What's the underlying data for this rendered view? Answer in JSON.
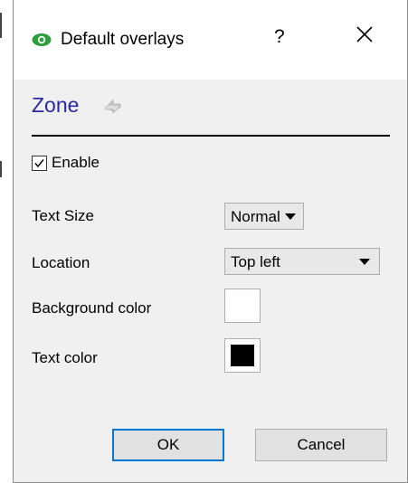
{
  "window": {
    "title": "Default overlays",
    "help_label": "?",
    "close_label": "✕",
    "icon": "eye-icon"
  },
  "section": {
    "title": "Zone",
    "icon": "refresh-arrows-icon"
  },
  "enable": {
    "label": "Enable",
    "checked": true
  },
  "text_size": {
    "label": "Text Size",
    "value": "Normal"
  },
  "location": {
    "label": "Location",
    "value": "Top left"
  },
  "background_color": {
    "label": "Background color",
    "value": "#ffffff"
  },
  "text_color": {
    "label": "Text color",
    "value": "#000000"
  },
  "buttons": {
    "ok": "OK",
    "cancel": "Cancel"
  },
  "colors": {
    "section_title": "#2a2aa0",
    "eye_icon": "#2e9e3e",
    "default_button_border": "#0078d7"
  }
}
